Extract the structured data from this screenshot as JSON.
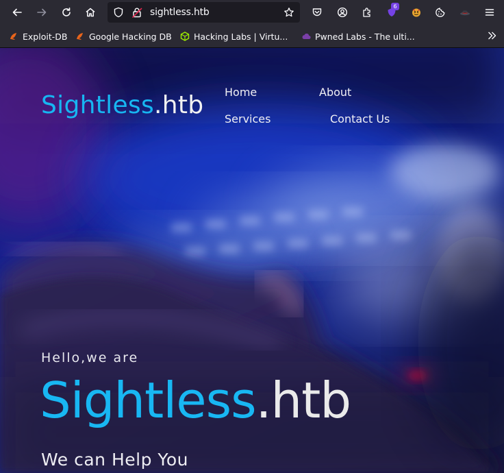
{
  "browser": {
    "url": "sightless.htb",
    "extension_badge": "6",
    "bookmarks": [
      {
        "label": "Exploit-DB"
      },
      {
        "label": "Google Hacking DB"
      },
      {
        "label": "Hacking Labs | Virtu..."
      },
      {
        "label": "Pwned Labs - The ulti..."
      }
    ]
  },
  "site": {
    "logo": {
      "part1": "Sightless",
      "part2": ".htb"
    },
    "nav": {
      "home": "Home",
      "about": "About",
      "services": "Services",
      "contact": "Contact Us"
    },
    "hero": {
      "greeting": "Hello,we are",
      "title_part1": "Sightless",
      "title_part2": ".htb",
      "tagline": "We can Help You"
    }
  },
  "colors": {
    "brand_blue": "#17b6f2",
    "toolbar": "#2b2a33",
    "urlbar": "#1c1b22",
    "badge": "#7542e5"
  }
}
